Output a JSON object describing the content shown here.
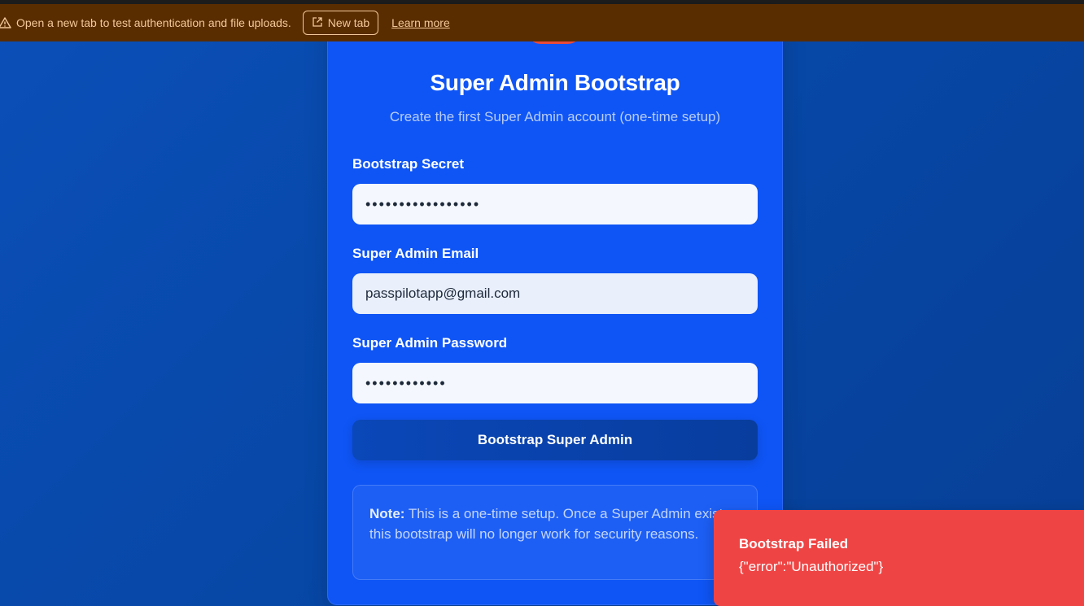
{
  "banner": {
    "message": "Open a new tab to test authentication and file uploads.",
    "new_tab_label": "New tab",
    "learn_more_label": "Learn more"
  },
  "form": {
    "title": "Super Admin Bootstrap",
    "subtitle": "Create the first Super Admin account (one-time setup)",
    "secret_label": "Bootstrap Secret",
    "secret_value": "•••••••••••••••••",
    "email_label": "Super Admin Email",
    "email_value": "passpilotapp@gmail.com",
    "password_label": "Super Admin Password",
    "password_value": "••••••••••••",
    "submit_label": "Bootstrap Super Admin",
    "note_heading": "Note:",
    "note_text": " This is a one-time setup. Once a Super Admin exists, this bootstrap will no longer work for security reasons."
  },
  "toast": {
    "title": "Bootstrap Failed",
    "description": "{\"error\":\"Unauthorized\"}"
  },
  "colors": {
    "background": "#0748a8",
    "card": "#0f55f5",
    "banner": "#5a2d00",
    "toast": "#ef4444"
  }
}
